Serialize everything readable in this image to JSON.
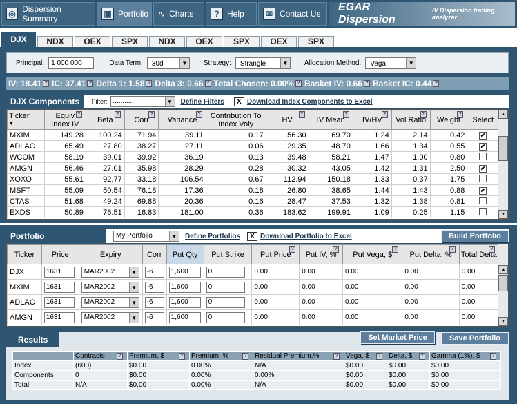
{
  "nav": {
    "items": [
      {
        "label": "Dispersion Summary",
        "icon": "target-icon"
      },
      {
        "label": "Portfolio",
        "icon": "briefcase-icon"
      },
      {
        "label": "Charts",
        "icon": "chart-icon"
      },
      {
        "label": "Help",
        "icon": "help-icon"
      },
      {
        "label": "Contact Us",
        "icon": "mail-icon"
      }
    ],
    "brand": "EGAR Dispersion",
    "tagline": "IV Dispersion trading analyzer"
  },
  "tabs": [
    "DJX",
    "NDX",
    "OEX",
    "SPX",
    "NDX",
    "OEX",
    "SPX",
    "OEX",
    "SPX"
  ],
  "params": {
    "principal_label": "Principal:",
    "principal_value": "1 000 000",
    "term_label": "Data Term:",
    "term_value": "30d",
    "strategy_label": "Strategy:",
    "strategy_value": "Strangle",
    "alloc_label": "Allocation Method:",
    "alloc_value": "Vega"
  },
  "stats": [
    "IV: 18.41",
    "IC: 37.41",
    "Delta 1: 1.58",
    "Delta 3: 0.66",
    "Total Chosen: 0.00%",
    "Basket IV: 0.66",
    "Basket IC: 0.44"
  ],
  "components": {
    "title": "DJX Components",
    "filter_label": "Filter:",
    "filter_value": "............",
    "define_filters": "Define Filters",
    "download": "Download Index Components to Excel",
    "columns": [
      "Ticker",
      "Equiv Index IV",
      "Beta",
      "Corr",
      "Variance",
      "Contribution To Index Voly",
      "HV",
      "IV Mean",
      "IV/HV",
      "Vol Ratio",
      "Weight",
      "Select"
    ],
    "rows": [
      [
        "MXIM",
        "149.28",
        "100.24",
        "71.94",
        "39.11",
        "0.17",
        "56.30",
        "69.70",
        "1.24",
        "2.14",
        "0.42",
        true
      ],
      [
        "ADLAC",
        "65.49",
        "27.80",
        "38.27",
        "27.11",
        "0.06",
        "29.35",
        "48.70",
        "1.66",
        "1.34",
        "0.55",
        true
      ],
      [
        "WCOM",
        "58.19",
        "39.01",
        "39.92",
        "36.19",
        "0.13",
        "39.48",
        "58.21",
        "1.47",
        "1.00",
        "0.80",
        false
      ],
      [
        "AMGN",
        "56.46",
        "27.01",
        "35.98",
        "28.29",
        "0.28",
        "30.32",
        "43.05",
        "1.42",
        "1.31",
        "2.50",
        true
      ],
      [
        "XOXO",
        "55.61",
        "92.77",
        "33.18",
        "106.54",
        "0.67",
        "112.94",
        "150.18",
        "1.33",
        "0.37",
        "1.75",
        false
      ],
      [
        "MSFT",
        "55.09",
        "50.54",
        "76.18",
        "17.36",
        "0.18",
        "26.80",
        "38.65",
        "1.44",
        "1.43",
        "0.88",
        true
      ],
      [
        "CTAS",
        "51.68",
        "49.24",
        "69.88",
        "20.36",
        "0.16",
        "28.47",
        "37.53",
        "1.32",
        "1.38",
        "0.81",
        false
      ],
      [
        "EXDS",
        "50.89",
        "76.51",
        "16.83",
        "181.00",
        "0.36",
        "183.62",
        "199.91",
        "1.09",
        "0.25",
        "1.15",
        false
      ]
    ]
  },
  "portfolio": {
    "title": "Portfolio",
    "select_value": "My Portfolio",
    "define": "Define Portfolios",
    "download": "Download Portfolio to Excel",
    "build": "Build Portfolio",
    "columns": [
      "Ticker",
      "Price",
      "Expiry",
      "Corr",
      "Put Qty",
      "Put Strike",
      "Put Price",
      "Put IV, %",
      "Put Vega, $",
      "Put Delta, %",
      "Total Delta"
    ],
    "rows": [
      [
        "DJX",
        "1631",
        "MAR2002",
        "-6",
        "1,600",
        "0",
        "0.00",
        "0.00",
        "0.00",
        "0.00",
        "0.00"
      ],
      [
        "MXIM",
        "1631",
        "MAR2002",
        "-6",
        "1,600",
        "0",
        "0.00",
        "0.00",
        "0.00",
        "0.00",
        "0.00"
      ],
      [
        "ADLAC",
        "1631",
        "MAR2002",
        "-6",
        "1,600",
        "0",
        "0.00",
        "0.00",
        "0.00",
        "0.00",
        "0.00"
      ],
      [
        "AMGN",
        "1631",
        "MAR2002",
        "-6",
        "1,600",
        "0",
        "0.00",
        "0.00",
        "0.00",
        "0.00",
        "0.00"
      ]
    ]
  },
  "results": {
    "title": "Results",
    "set_market": "Set Market Price",
    "save": "Save Portfolio",
    "columns": [
      "",
      "Contracts",
      "Premium, $",
      "Premium, %",
      "Residual Premium,%",
      "Vega, $",
      "Delta, $",
      "Gamma (1%), $"
    ],
    "rows": [
      [
        "Index",
        "(600)",
        "$0.00",
        "0.00%",
        "N/A",
        "$0.00",
        "$0.00",
        "$0.00"
      ],
      [
        "Components",
        "0",
        "$0.00",
        "0.00%",
        "0.00%",
        "$0.00",
        "$0.00",
        "$0.00"
      ],
      [
        "Total",
        "N/A",
        "$0.00",
        "0.00%",
        "N/A",
        "$0.00",
        "$0.00",
        "$0.00"
      ]
    ]
  }
}
